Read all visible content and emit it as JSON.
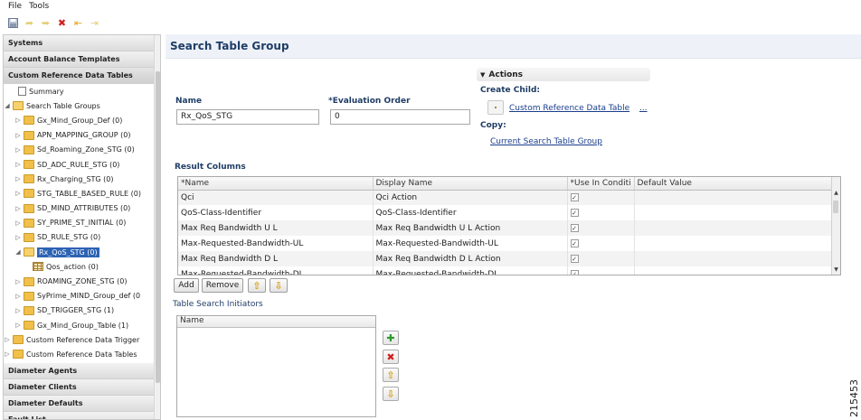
{
  "menu": [
    "File",
    "Tools"
  ],
  "toolbar": [
    {
      "icon": "save-icon"
    },
    {
      "icon": "forward-icon"
    },
    {
      "icon": "back-icon"
    },
    {
      "icon": "delete-icon"
    },
    {
      "icon": "import-icon"
    },
    {
      "icon": "export-icon"
    }
  ],
  "nav": {
    "systems": "Systems",
    "account_balance": "Account Balance Templates",
    "crdt": "Custom Reference Data Tables",
    "tree": {
      "summary": "Summary",
      "search_groups": "Search Table Groups",
      "items": [
        "Gx_Mind_Group_Def (0)",
        "APN_MAPPING_GROUP (0)",
        "Sd_Roaming_Zone_STG (0)",
        "SD_ADC_RULE_STG (0)",
        "Rx_Charging_STG (0)",
        "STG_TABLE_BASED_RULE (0)",
        "SD_MIND_ATTRIBUTES (0)",
        "SY_PRIME_ST_INITIAL (0)",
        "SD_RULE_STG (0)"
      ],
      "selected": "Rx_QoS_STG (0)",
      "child": "Qos_action (0)",
      "items_after": [
        "ROAMING_ZONE_STG (0)",
        "SyPrime_MIND_Group_def (0",
        "SD_TRIGGER_STG (1)",
        "Gx_Mind_Group_Table (1)"
      ],
      "trigger": "Custom Reference Data Trigger",
      "tables": "Custom Reference Data Tables"
    },
    "diameter_agents": "Diameter Agents",
    "diameter_clients": "Diameter Clients",
    "diameter_defaults": "Diameter Defaults",
    "fault_list": "Fault List"
  },
  "main": {
    "title": "Search Table Group",
    "name_label": "Name",
    "name_value": "Rx_QoS_STG",
    "eval_label": "*Evaluation Order",
    "eval_value": "0",
    "actions": {
      "header": "Actions",
      "create_child": "Create Child:",
      "crdt_link": "Custom Reference Data Table",
      "more": "...",
      "copy": "Copy:",
      "copy_link": "Current Search Table Group"
    },
    "result_columns": {
      "label": "Result Columns",
      "headers": [
        "*Name",
        "Display Name",
        "*Use In Conditi",
        "Default Value"
      ],
      "rows": [
        {
          "name": "Qci",
          "display": "Qci Action"
        },
        {
          "name": "QoS-Class-Identifier",
          "display": "QoS-Class-Identifier"
        },
        {
          "name": "Max Req Bandwidth U L",
          "display": "Max Req Bandwidth U L Action"
        },
        {
          "name": "Max-Requested-Bandwidth-UL",
          "display": "Max-Requested-Bandwidth-UL"
        },
        {
          "name": "Max Req Bandwidth D L",
          "display": "Max Req Bandwidth D L Action"
        },
        {
          "name": "Max-Requested-Bandwidth-DL",
          "display": "Max-Requested-Bandwidth-DL"
        }
      ],
      "add": "Add",
      "remove": "Remove"
    },
    "tsi": {
      "label": "Table Search Initiators",
      "header": "Name"
    }
  },
  "figure_number": "215453"
}
